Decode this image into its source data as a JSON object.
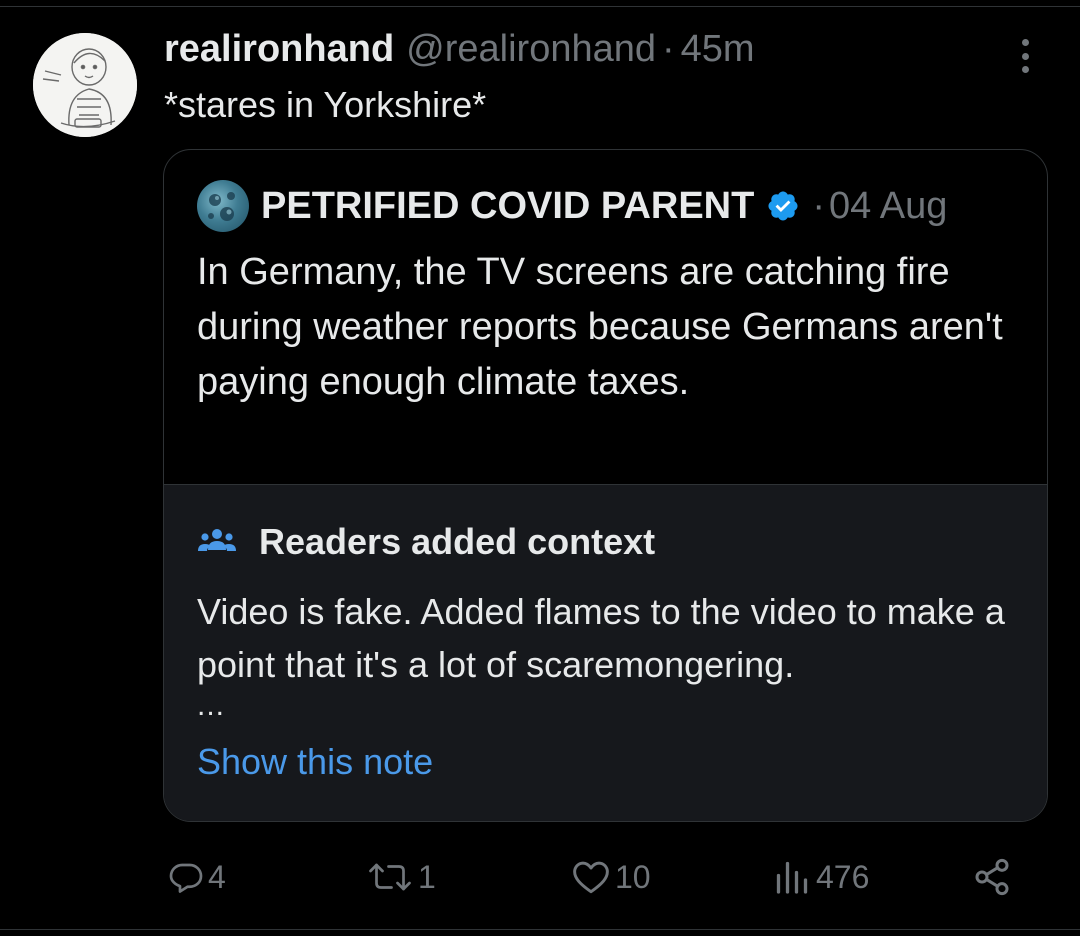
{
  "tweet": {
    "author": {
      "display_name": "realironhand",
      "handle": "@realironhand"
    },
    "separator": "·",
    "time": "45m",
    "text": "*stares in Yorkshire*"
  },
  "quoted": {
    "author": {
      "display_name": "PETRIFIED COVID PARENT",
      "verified": true
    },
    "separator": "·",
    "time": "04 Aug",
    "text": "In Germany, the TV screens are catching fire during weather reports because Germans aren't paying enough climate taxes."
  },
  "community_note": {
    "title": "Readers added context",
    "body": "Video is fake. Added flames to the video to make a point that it's a lot of scaremongering.",
    "ellipsis": "...",
    "link": "Show this note"
  },
  "actions": {
    "replies": "4",
    "reposts": "1",
    "likes": "10",
    "views": "476"
  },
  "icons": [
    "more-icon",
    "verified-badge-icon",
    "readers-icon",
    "reply-icon",
    "repost-icon",
    "like-icon",
    "views-icon",
    "share-icon"
  ],
  "colors": {
    "background": "#000000",
    "text": "#e7e9ea",
    "muted": "#71767b",
    "link": "#4a99e9",
    "verified": "#1d9bf0",
    "note_bg": "#16181c"
  }
}
